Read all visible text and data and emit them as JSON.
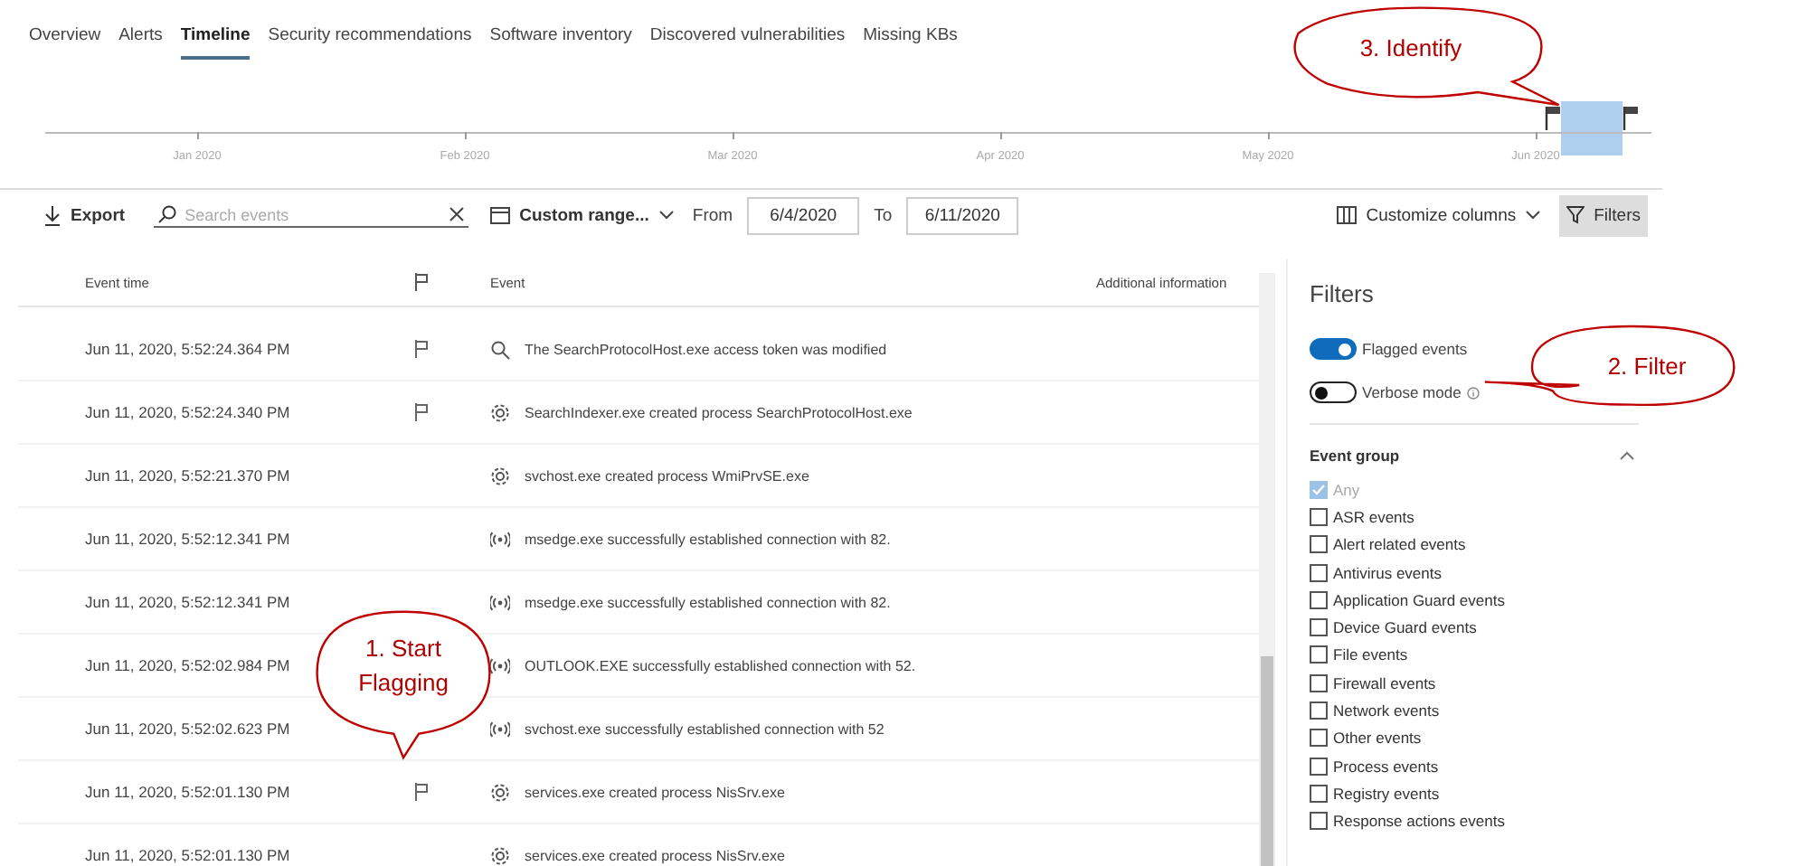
{
  "tabs": [
    {
      "label": "Overview",
      "selected": false
    },
    {
      "label": "Alerts",
      "selected": false
    },
    {
      "label": "Timeline",
      "selected": true
    },
    {
      "label": "Security recommendations",
      "selected": false
    },
    {
      "label": "Software inventory",
      "selected": false
    },
    {
      "label": "Discovered vulnerabilities",
      "selected": false
    },
    {
      "label": "Missing KBs",
      "selected": false
    }
  ],
  "timeline": {
    "months": [
      "Jan 2020",
      "Feb 2020",
      "Mar 2020",
      "Apr 2020",
      "May 2020",
      "Jun 2020"
    ]
  },
  "toolbar": {
    "export": "Export",
    "search": {
      "placeholder": "Search events"
    },
    "range": "Custom range...",
    "from_label": "From",
    "from": "6/4/2020",
    "to_label": "To",
    "to": "6/11/2020",
    "customize": "Customize columns",
    "filters": "Filters"
  },
  "table": {
    "columns": [
      "Event time",
      "Event",
      "Additional information"
    ],
    "rows": [
      {
        "time": "Jun 11, 2020, 5:52:24.364 PM",
        "flagged": true,
        "kind": "search",
        "event": "The SearchProtocolHost.exe access token was modified"
      },
      {
        "time": "Jun 11, 2020, 5:52:24.340 PM",
        "flagged": true,
        "kind": "process",
        "event": "SearchIndexer.exe created process SearchProtocolHost.exe"
      },
      {
        "time": "Jun 11, 2020, 5:52:21.370 PM",
        "flagged": false,
        "kind": "process",
        "event": "svchost.exe created process WmiPrvSE.exe"
      },
      {
        "time": "Jun 11, 2020, 5:52:12.341 PM",
        "flagged": false,
        "kind": "network",
        "event": "msedge.exe successfully established connection with 82."
      },
      {
        "time": "Jun 11, 2020, 5:52:12.341 PM",
        "flagged": false,
        "kind": "network",
        "event": "msedge.exe successfully established connection with 82."
      },
      {
        "time": "Jun 11, 2020, 5:52:02.984 PM",
        "kind": "network",
        "event": "OUTLOOK.EXE successfully established connection with 52."
      },
      {
        "time": "Jun 11, 2020, 5:52:02.623 PM",
        "kind": "network",
        "event": "svchost.exe successfully established connection with 52"
      },
      {
        "time": "Jun 11, 2020, 5:52:01.130 PM",
        "flagged": true,
        "kind": "process",
        "event": "services.exe created process NisSrv.exe"
      },
      {
        "time": "Jun 11, 2020, 5:52:01.130 PM",
        "flagged": false,
        "kind": "process",
        "event": "services.exe created process NisSrv.exe"
      }
    ]
  },
  "filters": {
    "title": "Filters",
    "toggles": [
      {
        "label": "Flagged events",
        "on": true,
        "info": false
      },
      {
        "label": "Verbose mode",
        "on": false,
        "info": true
      }
    ],
    "group": {
      "title": "Event group",
      "expanded": true,
      "items": [
        {
          "label": "Any",
          "checked": true,
          "disabled": true
        },
        {
          "label": "ASR events",
          "checked": false,
          "disabled": false
        },
        {
          "label": "Alert related events",
          "checked": false,
          "disabled": false
        },
        {
          "label": "Antivirus events",
          "checked": false,
          "disabled": false
        },
        {
          "label": "Application Guard events",
          "checked": false,
          "disabled": false
        },
        {
          "label": "Device Guard events",
          "checked": false,
          "disabled": false
        },
        {
          "label": "File events",
          "checked": false,
          "disabled": false
        },
        {
          "label": "Firewall events",
          "checked": false,
          "disabled": false
        },
        {
          "label": "Network events",
          "checked": false,
          "disabled": false
        },
        {
          "label": "Other events",
          "checked": false,
          "disabled": false
        },
        {
          "label": "Process events",
          "checked": false,
          "disabled": false
        },
        {
          "label": "Registry events",
          "checked": false,
          "disabled": false
        },
        {
          "label": "Response actions events",
          "checked": false,
          "disabled": false
        }
      ]
    }
  },
  "callouts": [
    {
      "text": "1. Start Flagging"
    },
    {
      "text": "2. Filter"
    },
    {
      "text": "3. Identify"
    }
  ]
}
